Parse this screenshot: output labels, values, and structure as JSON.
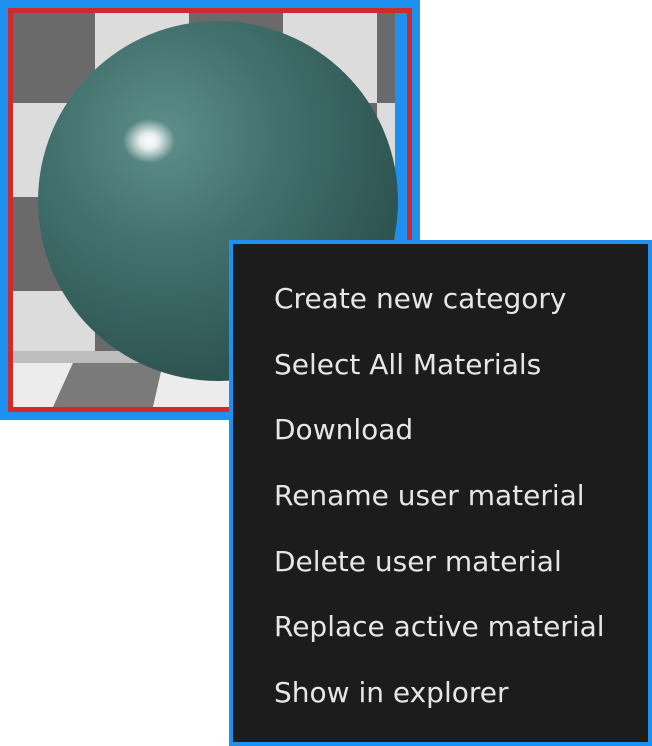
{
  "material_thumbnail": {
    "sphere_color": "#3f6b68",
    "selection_border_color": "#cf2b2b",
    "focus_border_color": "#1e90f0"
  },
  "context_menu": {
    "background": "#1c1c1c",
    "text_color": "#e6e6e6",
    "items": [
      {
        "label": "Create new category"
      },
      {
        "label": "Select All Materials"
      },
      {
        "label": "Download"
      },
      {
        "label": "Rename user material"
      },
      {
        "label": "Delete user material"
      },
      {
        "label": "Replace active material"
      },
      {
        "label": "Show in explorer"
      }
    ]
  }
}
